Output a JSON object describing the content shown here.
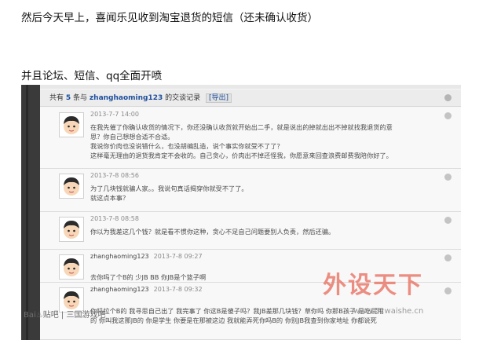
{
  "captions": {
    "line1": "然后今天早上，喜闻乐见收到淘宝退货的短信（还未确认收货）",
    "line2": "并且论坛、短信、qq全面开喷"
  },
  "header": {
    "prefix": "共有",
    "count": "5",
    "mid": "条与",
    "user": "zhanghaoming123",
    "suffix": "的交谈记录",
    "export_label": "[导出]"
  },
  "messages": [
    {
      "author": "",
      "time": "2013-7-7 14:00",
      "lines": [
        "在我先催了你确认收货的情况下，你还没确认收货就开始出二手，就是说出的掉就出出不掉就找我退货的意",
        "思？你自己想想合适不合适。",
        "我说你价肉也没说错什么，也没胡编乱造，说个事实你就受不了了？",
        "这样毫无理由的退货我肯定不会收的。自己贪心，价肉出不掉还怪我，你愿意来回查浪费邮费我陪你好了。"
      ]
    },
    {
      "author": "",
      "time": "2013-7-8 08:56",
      "lines": [
        "为了几块钱就骗人家。。我说句真话揭穿你就受不了了。",
        "就这点本事？"
      ]
    },
    {
      "author": "",
      "time": "2013-7-8 08:58",
      "lines": [
        "你以为我差这几个钱？就是看不惯你这种，贪心不足自己问题要别人负责，然后还骗。"
      ]
    },
    {
      "author": "zhanghaoming123",
      "time": "2013-7-8 09:27",
      "lines": [
        "去你吗了个B的  少JB  BB 你JB是个篮子啊"
      ]
    },
    {
      "author": "zhanghaoming123",
      "time": "2013-7-8 09:32",
      "lines": [
        "你吗拉个B的  我寻思自己出了  我完事了  你这B是傻子吗？我JB差那几块钱？草你吗  你那B孩子  是吃屁用",
        "的   你叫我这那JB的 你是学生  你要是在那被这边  我就能弄死你吗B的  你别JB我查到你家地址  你都说死"
      ]
    }
  ],
  "watermarks": {
    "left": "Bai♨贴吧 | 三国游戏吧",
    "logo": "外设天下",
    "url": "www.52waishe.cn"
  }
}
